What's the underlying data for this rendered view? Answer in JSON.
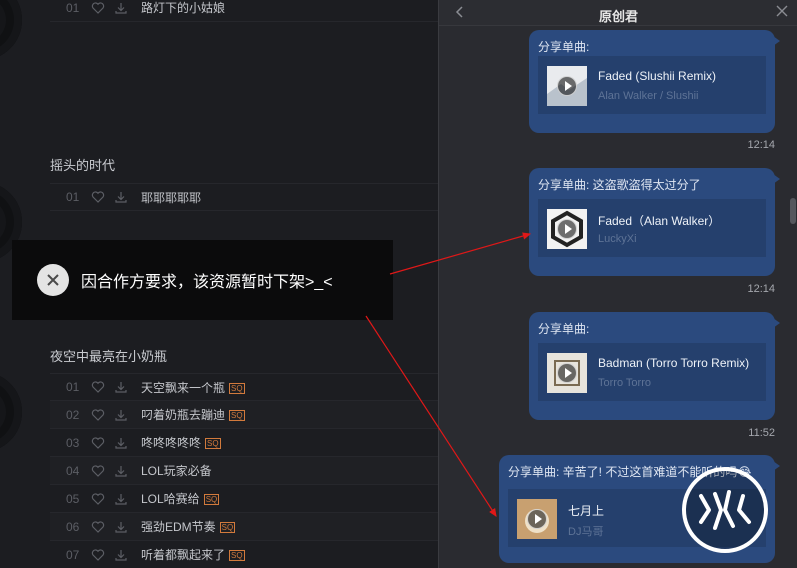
{
  "left_panel": {
    "top_row": {
      "number": "01",
      "title": "路灯下的小姑娘"
    },
    "album2": {
      "title": "摇头的时代",
      "rows": [
        {
          "number": "01",
          "title": "耶耶耶耶耶"
        }
      ]
    },
    "album3": {
      "title": "夜空中最亮在小奶瓶",
      "rows": [
        {
          "number": "01",
          "title": "天空飘来一个瓶",
          "sq": true
        },
        {
          "number": "02",
          "title": "叼着奶瓶去蹦迪",
          "sq": true
        },
        {
          "number": "03",
          "title": "咚咚咚咚咚",
          "sq": true
        },
        {
          "number": "04",
          "title": "LOL玩家必备",
          "sq": false
        },
        {
          "number": "05",
          "title": "LOL哈赛给",
          "sq": true
        },
        {
          "number": "06",
          "title": "强劲EDM节奏",
          "sq": true
        },
        {
          "number": "07",
          "title": "听着都飘起来了",
          "sq": true
        }
      ]
    },
    "sq_badge": "SQ"
  },
  "toast": {
    "icon": "close-circle-icon",
    "message": "因合作方要求，该资源暂时下架>_<"
  },
  "chat": {
    "title": "原创君",
    "messages": [
      {
        "caption": "分享单曲:",
        "song": "Faded (Slushii Remix)",
        "artist": "Alan Walker / Slushii",
        "time": "12:14"
      },
      {
        "caption": "分享单曲: 这盗歌盗得太过分了",
        "song": "Faded（Alan Walker）",
        "artist": "LuckyXi",
        "time": "12:14"
      },
      {
        "caption": "分享单曲:",
        "song": "Badman (Torro Torro Remix)",
        "artist": "Torro Torro",
        "time": "11:52"
      },
      {
        "caption": "分享单曲: 辛苦了! 不过这首难道不能听的吗",
        "emoji": "😂",
        "song": "七月上",
        "artist": "DJ马哥"
      }
    ]
  },
  "colors": {
    "bubble": "#2b4a7e",
    "card": "#25406d",
    "arrow": "#e01818",
    "sq": "#d27a3c"
  },
  "icons": [
    "heart-icon",
    "download-icon",
    "play-icon",
    "back-arrow-icon",
    "close-icon",
    "watermark-logo"
  ]
}
